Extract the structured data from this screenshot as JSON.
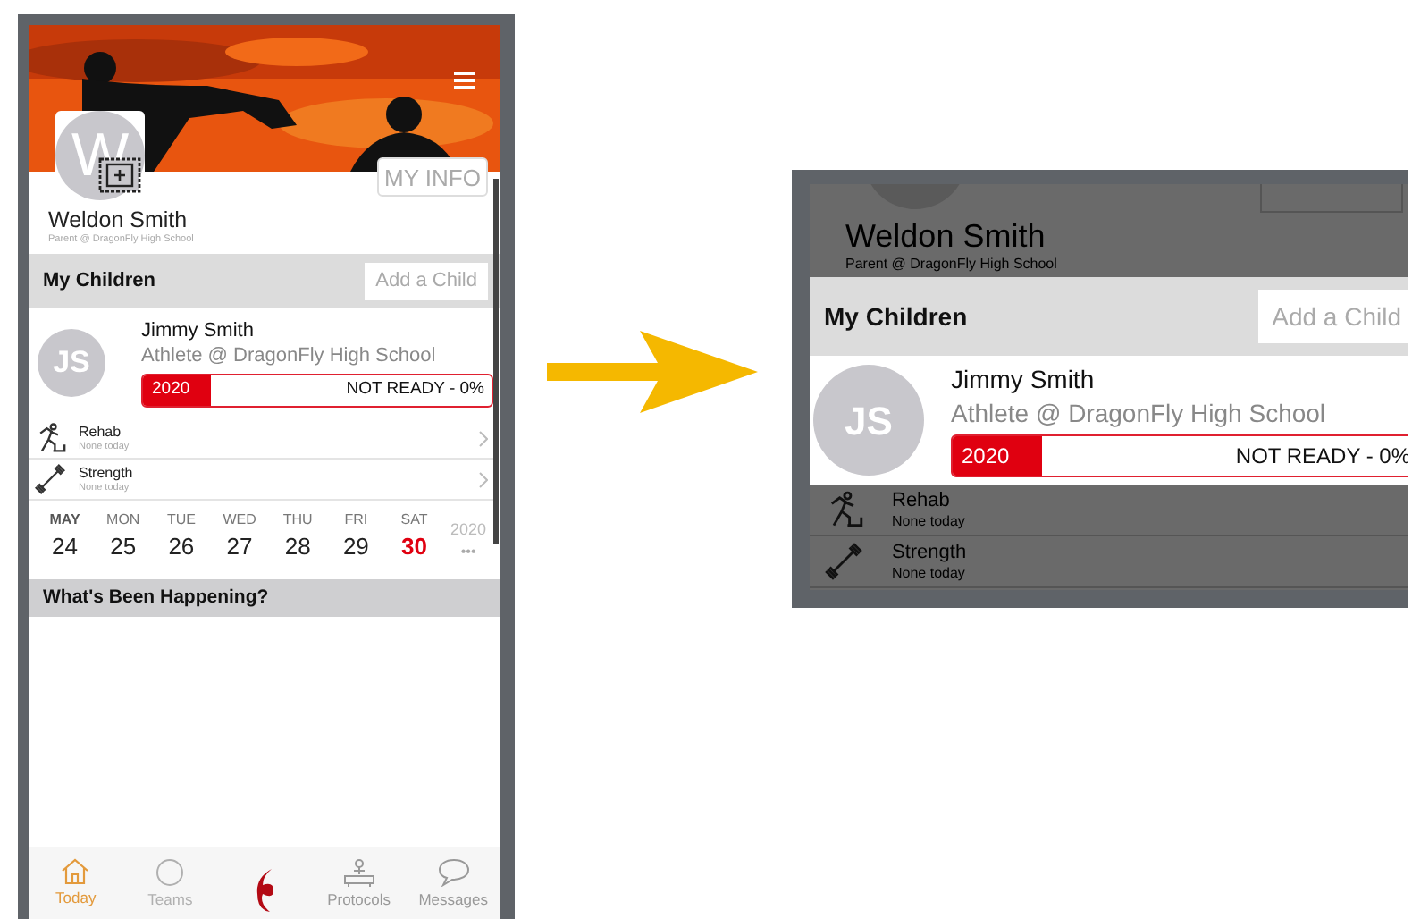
{
  "phone": {
    "profile": {
      "initial": "W",
      "name": "Weldon Smith",
      "role": "Parent @ DragonFly High School",
      "my_info": "MY INFO"
    },
    "children_section": {
      "title": "My Children",
      "add_button": "Add a Child"
    },
    "child": {
      "initials": "JS",
      "name": "Jimmy Smith",
      "role": "Athlete @ DragonFly High School",
      "season": "2020",
      "status": "NOT READY - 0%"
    },
    "activities": [
      {
        "kind": "rehab",
        "name": "Rehab",
        "note": "None today"
      },
      {
        "kind": "strength",
        "name": "Strength",
        "note": "None today"
      }
    ],
    "week": {
      "year": "2020",
      "more": "•••",
      "days": [
        {
          "label": "MAY",
          "date": "24",
          "selected": false
        },
        {
          "label": "MON",
          "date": "25",
          "selected": false
        },
        {
          "label": "TUE",
          "date": "26",
          "selected": false
        },
        {
          "label": "WED",
          "date": "27",
          "selected": false
        },
        {
          "label": "THU",
          "date": "28",
          "selected": false
        },
        {
          "label": "FRI",
          "date": "29",
          "selected": false
        },
        {
          "label": "SAT",
          "date": "30",
          "selected": true
        }
      ]
    },
    "feed_title": "What's Been Happening?",
    "bottom_nav": [
      {
        "kind": "home",
        "label": "Today",
        "selected": true
      },
      {
        "kind": "teams",
        "label": "Teams",
        "selected": false
      },
      {
        "kind": "logo",
        "selected": false
      },
      {
        "kind": "protocols",
        "label": "Protocols",
        "selected": false
      },
      {
        "kind": "messages",
        "label": "Messages",
        "selected": false
      }
    ]
  },
  "callout": {
    "name": "Weldon Smith",
    "role": "Parent @ DragonFly High School",
    "section_title": "My Children",
    "add_button": "Add a Child",
    "child": {
      "initials": "JS",
      "name": "Jimmy Smith",
      "role": "Athlete @ DragonFly High School",
      "season": "2020",
      "status": "NOT READY - 0%"
    },
    "activities": [
      {
        "kind": "rehab",
        "name": "Rehab",
        "note": "None today"
      },
      {
        "kind": "strength",
        "name": "Strength",
        "note": "None today"
      }
    ]
  }
}
